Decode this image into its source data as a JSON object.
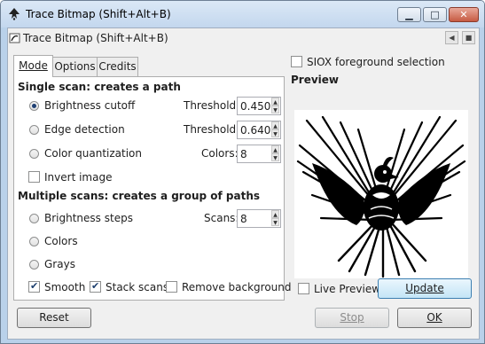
{
  "window": {
    "title": "Trace Bitmap (Shift+Alt+B)"
  },
  "dock": {
    "title": "Trace Bitmap (Shift+Alt+B)"
  },
  "tabs": [
    {
      "label": "Mode",
      "active": true
    },
    {
      "label": "Options",
      "active": false
    },
    {
      "label": "Credits",
      "active": false
    }
  ],
  "single_scan": {
    "heading": "Single scan: creates a path",
    "brightness": {
      "label": "Brightness cutoff",
      "checked": true,
      "param_label": "Threshold:",
      "value": "0.450"
    },
    "edge": {
      "label": "Edge detection",
      "checked": false,
      "param_label": "Threshold:",
      "value": "0.640"
    },
    "color_quant": {
      "label": "Color quantization",
      "checked": false,
      "param_label": "Colors:",
      "value": "8"
    },
    "invert": {
      "label": "Invert image",
      "checked": false
    }
  },
  "multiple_scans": {
    "heading": "Multiple scans: creates a group of paths",
    "brightness_steps": {
      "label": "Brightness steps",
      "checked": false,
      "param_label": "Scans:",
      "value": "8"
    },
    "colors": {
      "label": "Colors",
      "checked": false
    },
    "grays": {
      "label": "Grays",
      "checked": false
    },
    "smooth": {
      "label": "Smooth",
      "checked": true
    },
    "stack_scans": {
      "label": "Stack scans",
      "checked": true
    },
    "remove_background": {
      "label": "Remove background",
      "checked": false
    }
  },
  "siox": {
    "label": "SIOX foreground selection",
    "checked": false
  },
  "preview": {
    "heading": "Preview",
    "live_preview_label": "Live Preview",
    "live_preview_checked": false,
    "update_label": "Update"
  },
  "buttons": {
    "reset": "Reset",
    "stop": "Stop",
    "ok": "OK"
  },
  "colors": {
    "accent": "#1e3f73",
    "titlebar": "#c3d7ee"
  }
}
